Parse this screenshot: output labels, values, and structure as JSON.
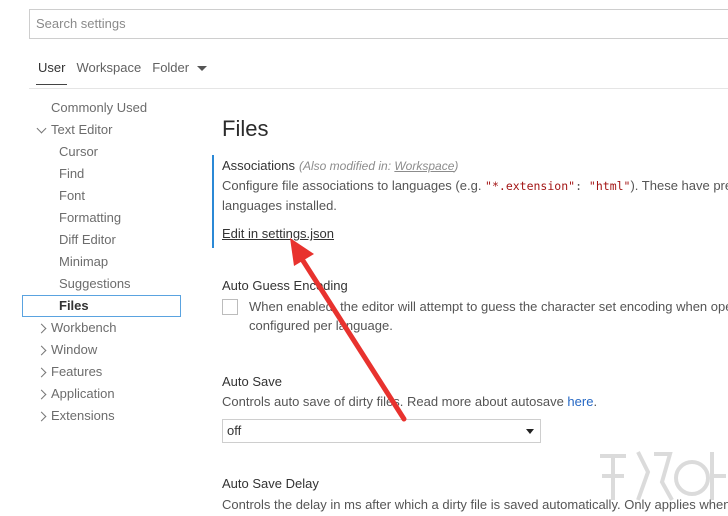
{
  "search": {
    "placeholder": "Search settings"
  },
  "scope_tabs": {
    "user": "User",
    "workspace": "Workspace",
    "folder": "Folder"
  },
  "toc": {
    "commonly_used": "Commonly Used",
    "text_editor": "Text Editor",
    "cursor": "Cursor",
    "find": "Find",
    "font": "Font",
    "formatting": "Formatting",
    "diff_editor": "Diff Editor",
    "minimap": "Minimap",
    "suggestions": "Suggestions",
    "files": "Files",
    "workbench": "Workbench",
    "window": "Window",
    "features": "Features",
    "application": "Application",
    "extensions": "Extensions"
  },
  "main": {
    "page_title": "Files",
    "associations": {
      "title": "Associations",
      "modified_prefix": "(Also modified in: ",
      "modified_scope": "Workspace",
      "modified_suffix": ")",
      "desc_part1": "Configure file associations to languages (e.g. ",
      "code_key": "\"*.extension\"",
      "code_sep": ": ",
      "code_val": "\"html\"",
      "desc_part2": "). These have pre",
      "desc_line2": "languages installed.",
      "edit_link": "Edit in settings.json"
    },
    "auto_guess_encoding": {
      "title": "Auto Guess Encoding",
      "desc_line1": "When enabled, the editor will attempt to guess the character set encoding when ope",
      "desc_line2": "configured per language."
    },
    "auto_save": {
      "title": "Auto Save",
      "desc": "Controls auto save of dirty files. Read more about autosave ",
      "desc_link": "here",
      "desc_end": ".",
      "value": "off"
    },
    "auto_save_delay": {
      "title": "Auto Save Delay",
      "desc": "Controls the delay in ms after which a dirty file is saved automatically. Only applies when"
    }
  },
  "colors": {
    "focus_bar": "#2b89d6",
    "link": "#2668c4",
    "annotation_arrow": "#e8322e"
  }
}
